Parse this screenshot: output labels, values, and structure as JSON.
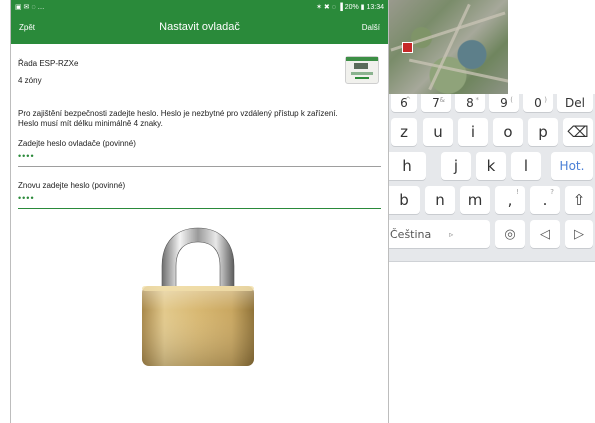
{
  "status_bar": {
    "left_icons": "▣ ✉ ◌ …",
    "right_text": "✶ ✖ ◌ ▐ 20% ▮ 13:34"
  },
  "app_bar": {
    "back_label": "Zpět",
    "title": "Nastavit ovladač",
    "next_label": "Další"
  },
  "content": {
    "series": "Řada ESP-RZXe",
    "zones": "4 zóny",
    "info_line1": "Pro zajištění bezpečnosti zadejte heslo. Heslo je nezbytné pro vzdálený přístup k zařízení.",
    "info_line2": "Heslo musí mít délku minimálně 4 znaky.",
    "password_label": "Zadejte heslo ovladače (povinné)",
    "password_value": "••••",
    "confirm_label": "Znovu zadejte heslo (povinné)",
    "confirm_value": "••••"
  },
  "keyboard": {
    "row0": [
      {
        "key": "6",
        "sup": "^"
      },
      {
        "key": "7",
        "sup": "&"
      },
      {
        "key": "8",
        "sup": "*"
      },
      {
        "key": "9",
        "sup": "("
      },
      {
        "key": "0",
        "sup": ")"
      },
      {
        "key": "Del",
        "sup": ""
      }
    ],
    "row1": [
      "z",
      "u",
      "i",
      "o",
      "p",
      "⌫"
    ],
    "row2": [
      "h",
      "j",
      "k",
      "l",
      "Hot."
    ],
    "row3": [
      "b",
      "n",
      "m",
      ",",
      "."
    ],
    "row3_sups": [
      "",
      "",
      "",
      "!",
      "?"
    ],
    "row3_extra": "⇧",
    "row4": {
      "lang": "Čeština",
      "lang_arrow": "▹",
      "globe": "◎",
      "left": "◁",
      "right": "▷"
    }
  },
  "colors": {
    "brand_green": "#2a8a3a",
    "keyboard_bg": "#e6e8eb",
    "hot_key": "#4a7fd6"
  },
  "icons": [
    "aerial-map-image",
    "controller-device-image",
    "padlock-image",
    "backspace-icon",
    "shift-icon",
    "globe-icon",
    "arrow-left-icon",
    "arrow-right-icon"
  ]
}
